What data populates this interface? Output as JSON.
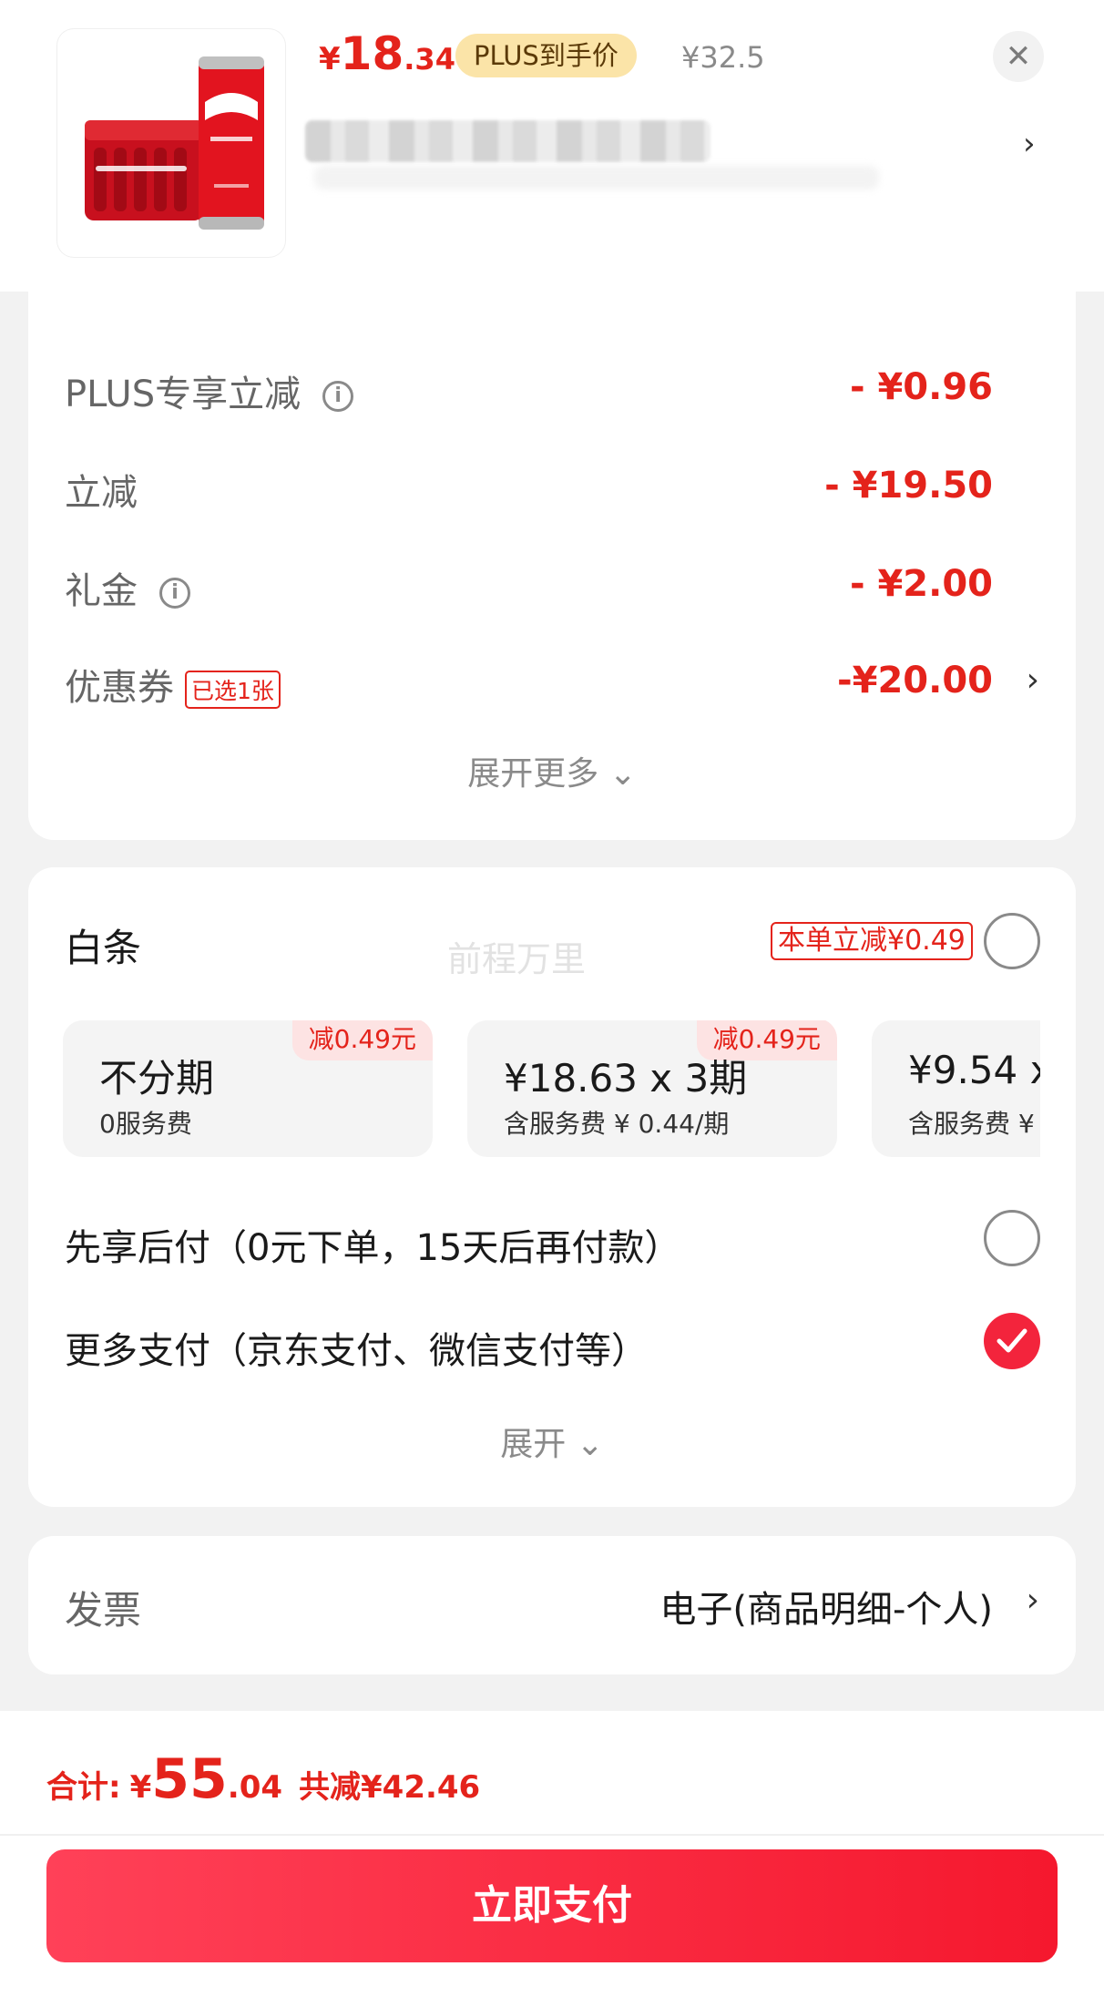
{
  "product": {
    "price_yen": "¥",
    "price_int": "18",
    "price_dec": ".34",
    "plus_badge": "PLUS到手价",
    "original_price": "¥32.5",
    "close_icon": "close-icon",
    "chevron": "›"
  },
  "discounts": {
    "items": [
      {
        "label": "PLUS专享立减",
        "value": "- ¥0.96",
        "icon": "ⓘ"
      },
      {
        "label": "立减",
        "value": "- ¥19.50"
      },
      {
        "label": "礼金",
        "value": "- ¥2.00",
        "icon": "ⓘ"
      },
      {
        "label": "优惠券",
        "tag": "已选1张",
        "value": "-¥20.00",
        "chevron": "›"
      }
    ],
    "expand_more": "展开更多 ⌄"
  },
  "payment": {
    "baitiao": {
      "title": "白条",
      "tag": "本单立减¥0.49",
      "watermark": "前程万里",
      "installments": [
        {
          "main": "不分期",
          "sub": "0服务费",
          "badge": "减0.49元"
        },
        {
          "main": "¥18.63 x 3期",
          "sub": "含服务费 ¥ 0.44/期",
          "badge": "减0.49元"
        },
        {
          "main": "¥9.54 x",
          "sub": "含服务费 ¥"
        }
      ]
    },
    "options": [
      {
        "label": "先享后付（0元下单，15天后再付款）",
        "checked": false
      },
      {
        "label": "更多支付（京东支付、微信支付等）",
        "checked": true
      }
    ],
    "expand": "展开 ⌄"
  },
  "invoice": {
    "label": "发票",
    "value": "电子(商品明细-个人)",
    "chevron": "›"
  },
  "footer": {
    "total_label": "合计:",
    "total_yen": "¥",
    "total_int": "55",
    "total_dec": ".04",
    "total_saved": "共减¥42.46",
    "pay_button": "立即支付"
  },
  "colors": {
    "accent_red": "#e4231b",
    "button_red": "#f5182e",
    "plus_gold": "#fbe4a8"
  }
}
